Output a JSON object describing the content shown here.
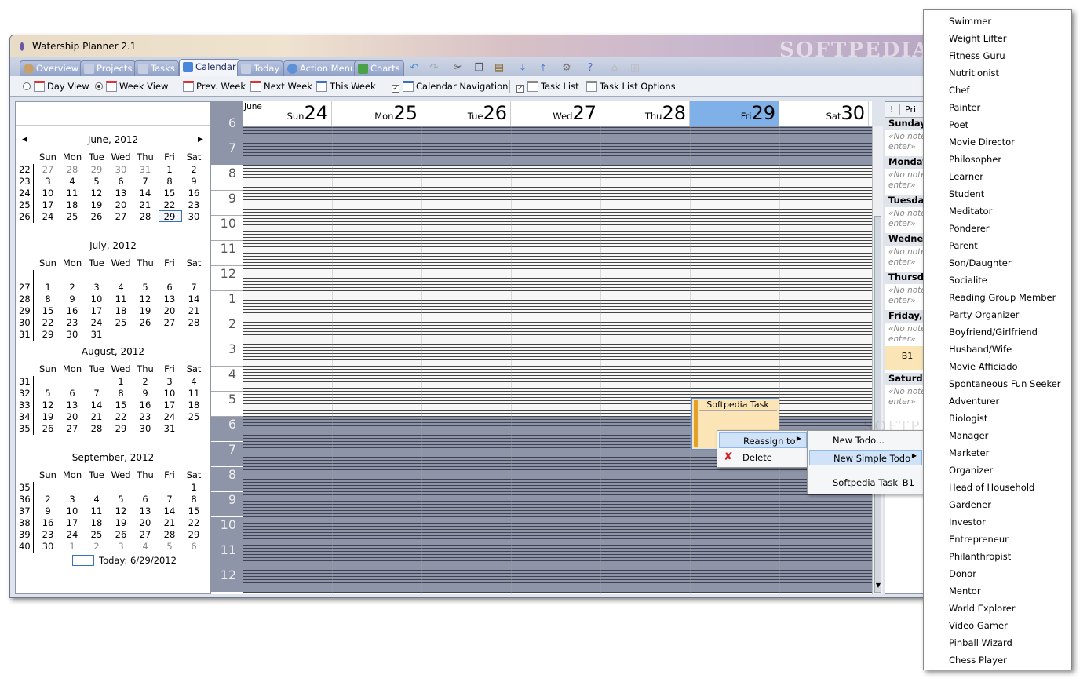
{
  "app": {
    "title": "Watership Planner 2.1",
    "watermark": "SOFTPEDIA"
  },
  "tabs": [
    {
      "label": "Overview",
      "color": "#c9a06c"
    },
    {
      "label": "Projects",
      "color": "#9ba7c9"
    },
    {
      "label": "Tasks",
      "color": "#9ba7c9"
    },
    {
      "label": "Calendar",
      "color": "#4a86d9"
    },
    {
      "label": "Today",
      "color": "#9ba7c9"
    },
    {
      "label": "Action Menu",
      "color": "#5d91d6"
    },
    {
      "label": "Charts",
      "color": "#4aa14a"
    }
  ],
  "toolbar_icons": [
    "undo-icon",
    "redo-icon",
    "cut-icon",
    "copy-icon",
    "paste-icon",
    "import-icon",
    "export-icon",
    "settings-icon",
    "help-icon",
    "disabled-icon",
    "print-icon"
  ],
  "options": {
    "day_view": "Day View",
    "week_view": "Week View",
    "prev_week": "Prev. Week",
    "next_week": "Next Week",
    "this_week": "This Week",
    "calendar_navigation": "Calendar Navigation",
    "task_list": "Task List",
    "task_list_options": "Task List Options"
  },
  "minicals": [
    {
      "title": "June, 2012",
      "weeks": [
        {
          "wk": "22",
          "days": [
            "27",
            "28",
            "29",
            "30",
            "31",
            "1",
            "2"
          ],
          "grey": [
            0,
            1,
            2,
            3,
            4
          ]
        },
        {
          "wk": "23",
          "days": [
            "3",
            "4",
            "5",
            "6",
            "7",
            "8",
            "9"
          ],
          "grey": []
        },
        {
          "wk": "24",
          "days": [
            "10",
            "11",
            "12",
            "13",
            "14",
            "15",
            "16"
          ],
          "grey": []
        },
        {
          "wk": "25",
          "days": [
            "17",
            "18",
            "19",
            "20",
            "21",
            "22",
            "23"
          ],
          "grey": []
        },
        {
          "wk": "26",
          "days": [
            "24",
            "25",
            "26",
            "27",
            "28",
            "29",
            "30"
          ],
          "grey": []
        }
      ]
    },
    {
      "title": "July, 2012",
      "weeks": [
        {
          "wk": "",
          "days": [
            "",
            "",
            "",
            "",
            "",
            "",
            ""
          ],
          "grey": []
        },
        {
          "wk": "27",
          "days": [
            "1",
            "2",
            "3",
            "4",
            "5",
            "6",
            "7"
          ],
          "grey": []
        },
        {
          "wk": "28",
          "days": [
            "8",
            "9",
            "10",
            "11",
            "12",
            "13",
            "14"
          ],
          "grey": []
        },
        {
          "wk": "29",
          "days": [
            "15",
            "16",
            "17",
            "18",
            "19",
            "20",
            "21"
          ],
          "grey": []
        },
        {
          "wk": "30",
          "days": [
            "22",
            "23",
            "24",
            "25",
            "26",
            "27",
            "28"
          ],
          "grey": []
        },
        {
          "wk": "31",
          "days": [
            "29",
            "30",
            "31",
            "",
            "",
            "",
            ""
          ],
          "grey": []
        }
      ]
    },
    {
      "title": "August, 2012",
      "weeks": [
        {
          "wk": "31",
          "days": [
            "",
            "",
            "",
            "1",
            "2",
            "3",
            "4"
          ],
          "grey": []
        },
        {
          "wk": "32",
          "days": [
            "5",
            "6",
            "7",
            "8",
            "9",
            "10",
            "11"
          ],
          "grey": []
        },
        {
          "wk": "33",
          "days": [
            "12",
            "13",
            "14",
            "15",
            "16",
            "17",
            "18"
          ],
          "grey": []
        },
        {
          "wk": "34",
          "days": [
            "19",
            "20",
            "21",
            "22",
            "23",
            "24",
            "25"
          ],
          "grey": []
        },
        {
          "wk": "35",
          "days": [
            "26",
            "27",
            "28",
            "29",
            "30",
            "31",
            ""
          ],
          "grey": []
        }
      ]
    },
    {
      "title": "September, 2012",
      "weeks": [
        {
          "wk": "35",
          "days": [
            "",
            "",
            "",
            "",
            "",
            "",
            "1"
          ],
          "grey": []
        },
        {
          "wk": "36",
          "days": [
            "2",
            "3",
            "4",
            "5",
            "6",
            "7",
            "8"
          ],
          "grey": []
        },
        {
          "wk": "37",
          "days": [
            "9",
            "10",
            "11",
            "12",
            "13",
            "14",
            "15"
          ],
          "grey": []
        },
        {
          "wk": "38",
          "days": [
            "16",
            "17",
            "18",
            "19",
            "20",
            "21",
            "22"
          ],
          "grey": []
        },
        {
          "wk": "39",
          "days": [
            "23",
            "24",
            "25",
            "26",
            "27",
            "28",
            "29"
          ],
          "grey": []
        },
        {
          "wk": "40",
          "days": [
            "30",
            "1",
            "2",
            "3",
            "4",
            "5",
            "6"
          ],
          "grey": [
            1,
            2,
            3,
            4,
            5,
            6
          ]
        }
      ]
    }
  ],
  "weekday_names": [
    "Sun",
    "Mon",
    "Tue",
    "Wed",
    "Thu",
    "Fri",
    "Sat"
  ],
  "today_label": "Today: 6/29/2012",
  "week": {
    "month_label": "June",
    "days": [
      {
        "name": "Sun",
        "num": "24"
      },
      {
        "name": "Mon",
        "num": "25"
      },
      {
        "name": "Tue",
        "num": "26"
      },
      {
        "name": "Wed",
        "num": "27"
      },
      {
        "name": "Thu",
        "num": "28"
      },
      {
        "name": "Fri",
        "num": "29",
        "selected": true
      },
      {
        "name": "Sat",
        "num": "30"
      }
    ],
    "hours": [
      {
        "label": "6",
        "night": true
      },
      {
        "label": "7",
        "night": true
      },
      {
        "label": "8",
        "night": false
      },
      {
        "label": "9",
        "night": false
      },
      {
        "label": "10",
        "night": false
      },
      {
        "label": "11",
        "night": false
      },
      {
        "label": "12",
        "night": false
      },
      {
        "label": "1",
        "night": false
      },
      {
        "label": "2",
        "night": false
      },
      {
        "label": "3",
        "night": false
      },
      {
        "label": "4",
        "night": false
      },
      {
        "label": "5",
        "night": false
      },
      {
        "label": "6",
        "night": true
      },
      {
        "label": "7",
        "night": true
      },
      {
        "label": "8",
        "night": true
      },
      {
        "label": "9",
        "night": true
      },
      {
        "label": "10",
        "night": true
      },
      {
        "label": "11",
        "night": true
      },
      {
        "label": "12",
        "night": true
      }
    ]
  },
  "task": {
    "title": "Softpedia Task"
  },
  "task_panel": {
    "col_excl": "!",
    "col_pri": "Pri",
    "days": [
      {
        "label": "Sunday",
        "note1": "«No note",
        "note2": "enter»"
      },
      {
        "label": "Monday",
        "note1": "«No note",
        "note2": "enter»"
      },
      {
        "label": "Tuesday",
        "note1": "«No note",
        "note2": "enter»"
      },
      {
        "label": "Wednes",
        "note1": "«No note",
        "note2": "enter»"
      },
      {
        "label": "Thursday",
        "note1": "«No note",
        "note2": "enter»"
      },
      {
        "label": "Friday, J",
        "note1": "«No note",
        "note2": "enter»",
        "extra": "B1"
      },
      {
        "label": "Saturday",
        "note1": "«No note",
        "note2": "enter»"
      }
    ]
  },
  "context_menu": {
    "reassign": "Reassign to",
    "delete": "Delete"
  },
  "submenu": {
    "new_todo": "New Todo...",
    "new_simple_todo": "New Simple Todo",
    "task_item": "Softpedia Task",
    "task_pri": "B1"
  },
  "roles": [
    "Swimmer",
    "Weight Lifter",
    "Fitness Guru",
    "Nutritionist",
    "Chef",
    "Painter",
    "Poet",
    "Movie Director",
    "Philosopher",
    "Learner",
    "Student",
    "Meditator",
    "Ponderer",
    "Parent",
    "Son/Daughter",
    "Socialite",
    "Reading Group Member",
    "Party Organizer",
    "Boyfriend/Girlfriend",
    "Husband/Wife",
    "Movie Afficiado",
    "Spontaneous Fun Seeker",
    "Adventurer",
    "Biologist",
    "Manager",
    "Marketer",
    "Organizer",
    "Head of Household",
    "Gardener",
    "Investor",
    "Entrepreneur",
    "Philanthropist",
    "Donor",
    "Mentor",
    "World Explorer",
    "Video Gamer",
    "Pinball Wizard",
    "Chess Player"
  ]
}
